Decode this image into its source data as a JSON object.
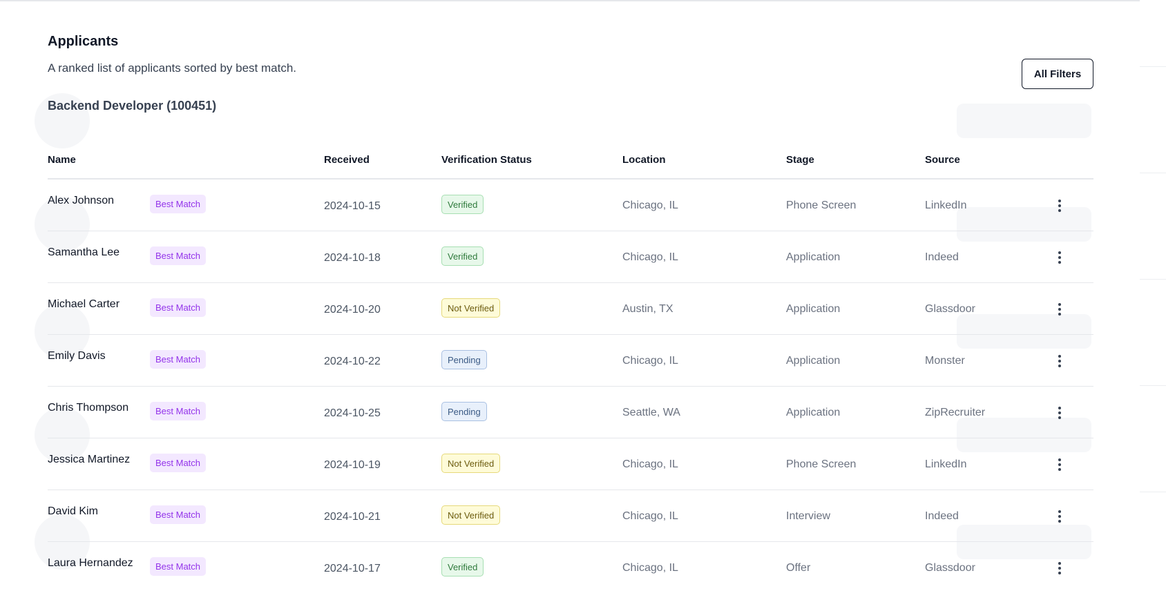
{
  "page": {
    "title": "Applicants",
    "subtitle": "A ranked list of applicants sorted by best match.",
    "filters_button": "All Filters",
    "job_title": "Backend Developer (100451)"
  },
  "table": {
    "headers": {
      "name": "Name",
      "received": "Received",
      "verification": "Verification Status",
      "location": "Location",
      "stage": "Stage",
      "source": "Source"
    },
    "rows": [
      {
        "name": "Alex Johnson",
        "badge": "Best Match",
        "received": "2024-10-15",
        "status": "Verified",
        "status_kind": "verified",
        "location": "Chicago, IL",
        "stage": "Phone Screen",
        "source": "LinkedIn"
      },
      {
        "name": "Samantha Lee",
        "badge": "Best Match",
        "received": "2024-10-18",
        "status": "Verified",
        "status_kind": "verified",
        "location": "Chicago, IL",
        "stage": "Application",
        "source": "Indeed"
      },
      {
        "name": "Michael Carter",
        "badge": "Best Match",
        "received": "2024-10-20",
        "status": "Not Verified",
        "status_kind": "notverified",
        "location": "Austin, TX",
        "stage": "Application",
        "source": "Glassdoor"
      },
      {
        "name": "Emily Davis",
        "badge": "Best Match",
        "received": "2024-10-22",
        "status": "Pending",
        "status_kind": "pending",
        "location": "Chicago, IL",
        "stage": "Application",
        "source": "Monster"
      },
      {
        "name": "Chris Thompson",
        "badge": "Best Match",
        "received": "2024-10-25",
        "status": "Pending",
        "status_kind": "pending",
        "location": "Seattle, WA",
        "stage": "Application",
        "source": "ZipRecruiter"
      },
      {
        "name": "Jessica Martinez",
        "badge": "Best Match",
        "received": "2024-10-19",
        "status": "Not Verified",
        "status_kind": "notverified",
        "location": "Chicago, IL",
        "stage": "Phone Screen",
        "source": "LinkedIn"
      },
      {
        "name": "David Kim",
        "badge": "Best Match",
        "received": "2024-10-21",
        "status": "Not Verified",
        "status_kind": "notverified",
        "location": "Chicago, IL",
        "stage": "Interview",
        "source": "Indeed"
      },
      {
        "name": "Laura Hernandez",
        "badge": "Best Match",
        "received": "2024-10-17",
        "status": "Verified",
        "status_kind": "verified",
        "location": "Chicago, IL",
        "stage": "Offer",
        "source": "Glassdoor"
      }
    ]
  },
  "icons": {
    "row_menu": "more-vertical-icon"
  },
  "colors": {
    "badge_bg": "#f3e8ff",
    "badge_text": "#9333ea",
    "verified": "#2f7a3c",
    "not_verified": "#6b5b0e",
    "pending": "#3a5a85"
  }
}
